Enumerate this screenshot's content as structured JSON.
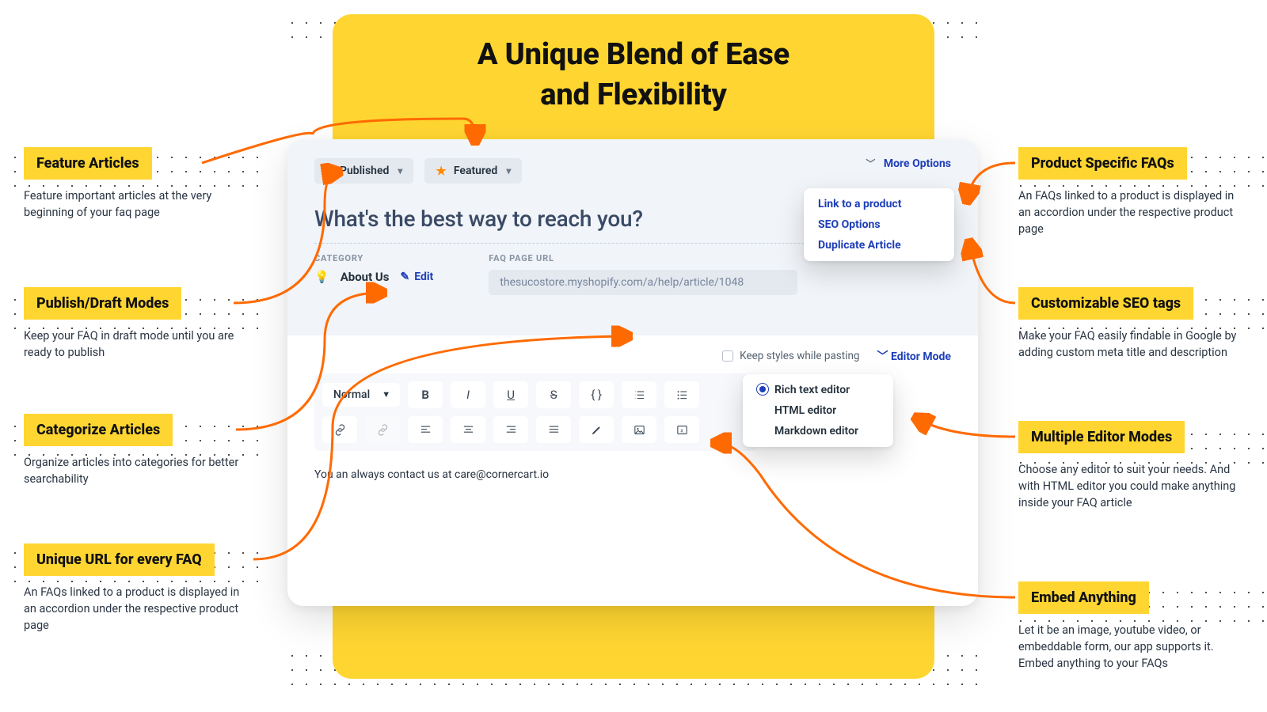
{
  "hero": {
    "title_l1": "A Unique Blend of Ease",
    "title_l2": "and Flexibility"
  },
  "card": {
    "published_label": "Published",
    "featured_label": "Featured",
    "more_options": "More Options",
    "title": "What's the best way to reach you?",
    "category_label": "CATEGORY",
    "category_name": "About Us",
    "edit": "Edit",
    "url_label": "FAQ PAGE URL",
    "url": "thesucostore.myshopify.com/a/help/article/1048",
    "paste_checkbox": "Keep styles while pasting",
    "editor_mode_label": "Editor Mode",
    "normal": "Normal",
    "content": "You an always contact us at care@cornercart.io"
  },
  "more_menu": {
    "item1": "Link to a product",
    "item2": "SEO Options",
    "item3": "Duplicate Article"
  },
  "editor_menu": {
    "item1": "Rich text editor",
    "item2": "HTML editor",
    "item3": "Markdown editor"
  },
  "left": {
    "c1_title": "Feature Articles",
    "c1_body": "Feature important articles at the very beginning of your faq page",
    "c2_title": "Publish/Draft Modes",
    "c2_body": "Keep your FAQ in draft mode until you are ready to publish",
    "c3_title": "Categorize Articles",
    "c3_body": "Organize articles into categories for better searchability",
    "c4_title": "Unique URL for every FAQ",
    "c4_body": "An FAQs linked to a product is displayed in an accordion under the respective product page"
  },
  "right": {
    "c1_title": "Product Specific FAQs",
    "c1_body": "An FAQs linked to a product is displayed in an accordion under the respective product page",
    "c2_title": "Customizable SEO tags",
    "c2_body": "Make your FAQ easily findable in Google by adding custom meta title and description",
    "c3_title": "Multiple Editor Modes",
    "c3_body": "Choose any editor to suit your needs. And with HTML editor you could make anything inside your FAQ article",
    "c4_title": "Embed Anything",
    "c4_body": "Let it be an image, youtube video, or embeddable form, our app supports it. Embed anything to your FAQs"
  }
}
